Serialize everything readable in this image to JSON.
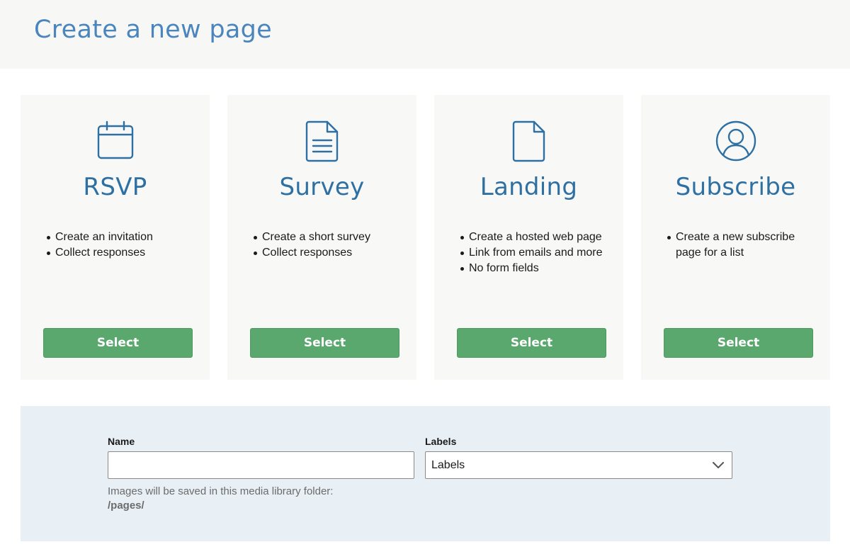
{
  "header": {
    "title": "Create a new page"
  },
  "cards": [
    {
      "icon": "calendar-icon",
      "title": "RSVP",
      "bullets": [
        "Create an invitation",
        "Collect responses"
      ],
      "button": "Select"
    },
    {
      "icon": "document-lines-icon",
      "title": "Survey",
      "bullets": [
        "Create a short survey",
        "Collect responses"
      ],
      "button": "Select"
    },
    {
      "icon": "blank-document-icon",
      "title": "Landing",
      "bullets": [
        "Create a hosted web page",
        "Link from emails and more",
        "No form fields"
      ],
      "button": "Select"
    },
    {
      "icon": "user-circle-icon",
      "title": "Subscribe",
      "bullets": [
        "Create a new subscribe",
        "page for a list"
      ],
      "button": "Select"
    }
  ],
  "form": {
    "name_label": "Name",
    "name_value": "",
    "labels_label": "Labels",
    "labels_value": "Labels",
    "help_text": "Images will be saved in this media library folder:",
    "folder_path": "/pages/"
  },
  "colors": {
    "title_blue": "#4a86bd",
    "icon_blue": "#2f70a3",
    "button_green": "#5aa86e",
    "panel_blue": "#e8f0f6"
  }
}
